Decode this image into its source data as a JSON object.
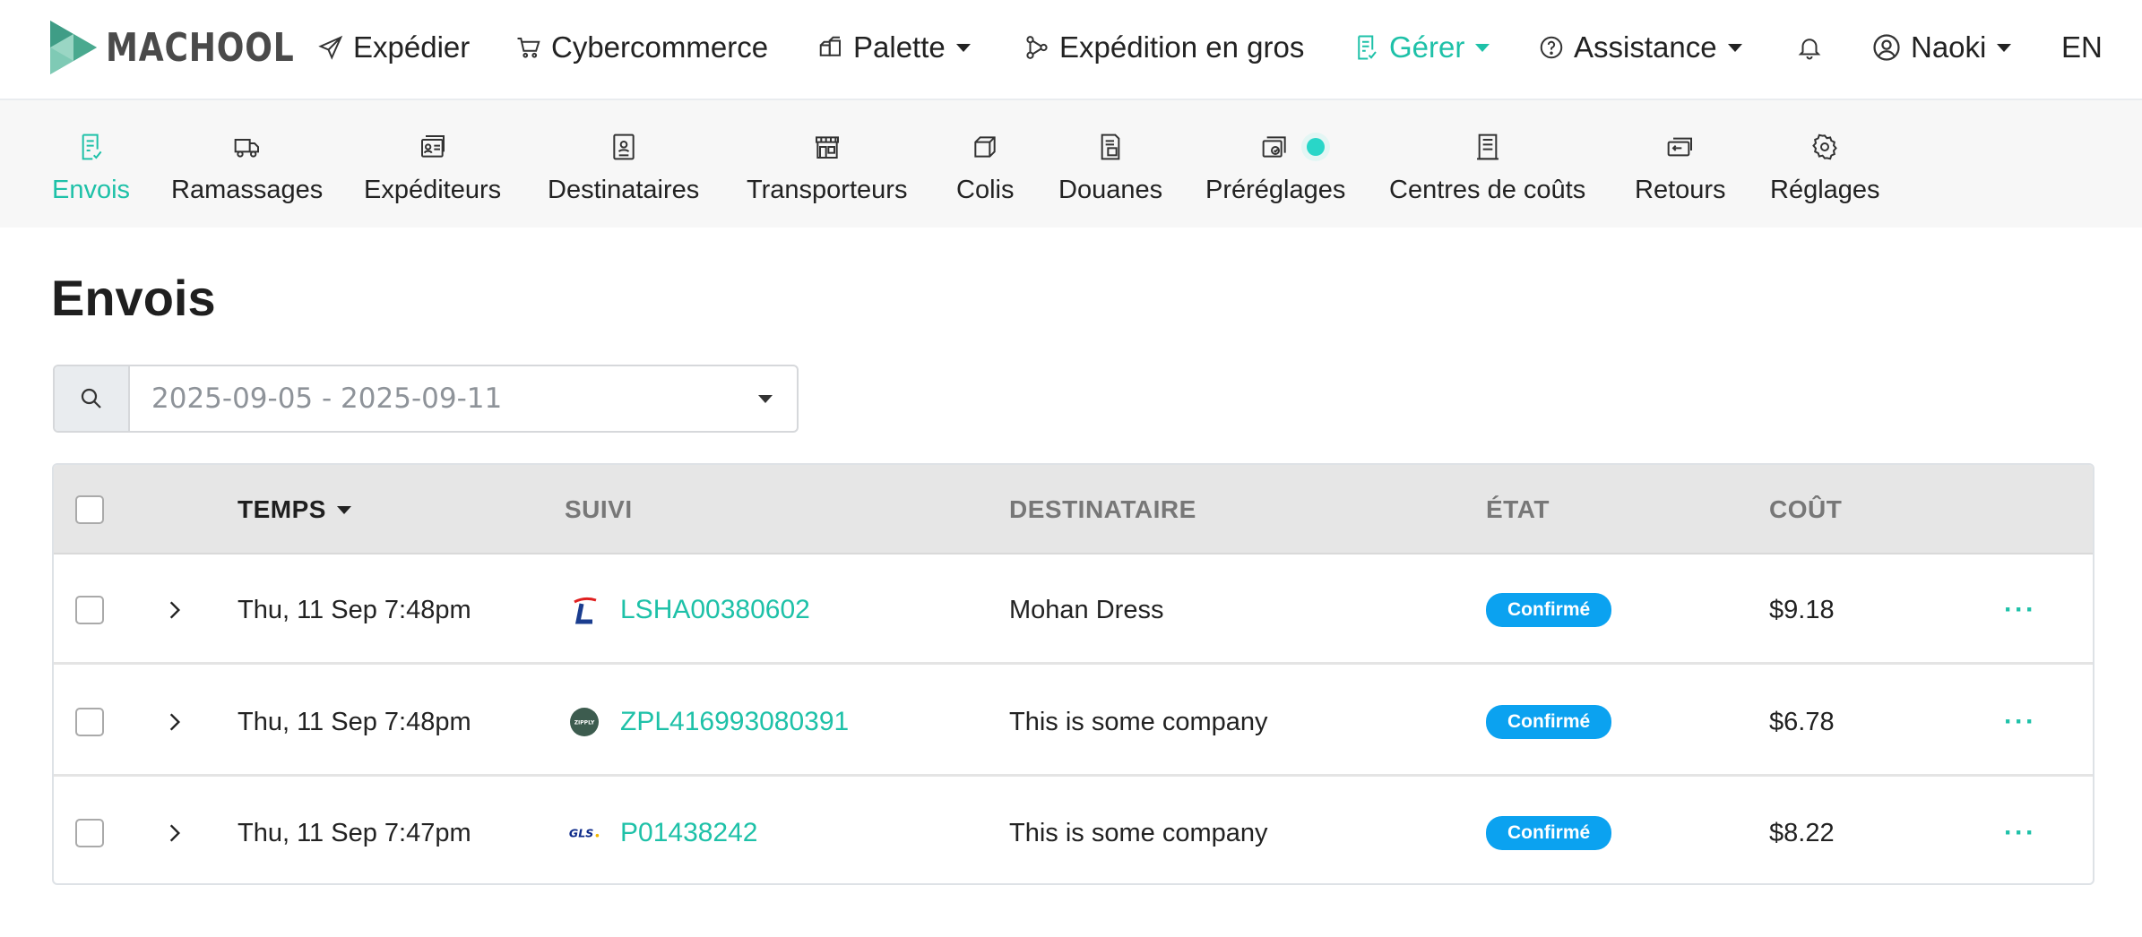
{
  "brand": {
    "name": "MACHOOL"
  },
  "topnav": {
    "items": [
      {
        "label": "Expédier",
        "icon": "paper-plane-icon",
        "dropdown": false
      },
      {
        "label": "Cybercommerce",
        "icon": "cart-icon",
        "dropdown": false
      },
      {
        "label": "Palette",
        "icon": "boxes-icon",
        "dropdown": true
      },
      {
        "label": "Expédition en gros",
        "icon": "nodes-icon",
        "dropdown": false
      },
      {
        "label": "Gérer",
        "icon": "document-check-icon",
        "dropdown": true,
        "active": true
      },
      {
        "label": "Assistance",
        "icon": "question-circle-icon",
        "dropdown": true
      }
    ],
    "user": {
      "name": "Naoki"
    },
    "language": "EN"
  },
  "subnav": {
    "items": [
      {
        "label": "Envois",
        "icon": "document-check-icon",
        "active": true
      },
      {
        "label": "Ramassages",
        "icon": "truck-icon"
      },
      {
        "label": "Expéditeurs",
        "icon": "contact-cards-icon"
      },
      {
        "label": "Destinataires",
        "icon": "contact-badge-icon"
      },
      {
        "label": "Transporteurs",
        "icon": "storefront-icon"
      },
      {
        "label": "Colis",
        "icon": "box-icon"
      },
      {
        "label": "Douanes",
        "icon": "customs-docs-icon"
      },
      {
        "label": "Préréglages",
        "icon": "presets-icon",
        "notification": true
      },
      {
        "label": "Centres de coûts",
        "icon": "building-icon"
      },
      {
        "label": "Retours",
        "icon": "return-box-icon"
      },
      {
        "label": "Réglages",
        "icon": "gear-icon"
      }
    ]
  },
  "page": {
    "title": "Envois"
  },
  "filter": {
    "date_range": "2025-09-05 - 2025-09-11"
  },
  "table": {
    "columns": {
      "time": "TEMPS",
      "tracking": "SUIVI",
      "recipient": "DESTINATAIRE",
      "status": "ÉTAT",
      "cost": "COÛT"
    },
    "rows": [
      {
        "time": "Thu, 11 Sep 7:48pm",
        "carrier_logo": "lasership-logo",
        "tracking": "LSHA00380602",
        "recipient": "Mohan Dress",
        "status": "Confirmé",
        "cost": "$9.18"
      },
      {
        "time": "Thu, 11 Sep 7:48pm",
        "carrier_logo": "zipply-logo",
        "carrier_logo_text": "ZIPPLY",
        "tracking": "ZPL416993080391",
        "recipient": "This is some company",
        "status": "Confirmé",
        "cost": "$6.78"
      },
      {
        "time": "Thu, 11 Sep 7:47pm",
        "carrier_logo": "gls-logo",
        "carrier_logo_text": "GLS",
        "tracking": "P01438242",
        "recipient": "This is some company",
        "status": "Confirmé",
        "cost": "$8.22"
      }
    ],
    "more_label": "···"
  },
  "colors": {
    "accent": "#1ec1a8",
    "badge": "#0ba2f0",
    "header_bg": "#e6e6e6"
  }
}
